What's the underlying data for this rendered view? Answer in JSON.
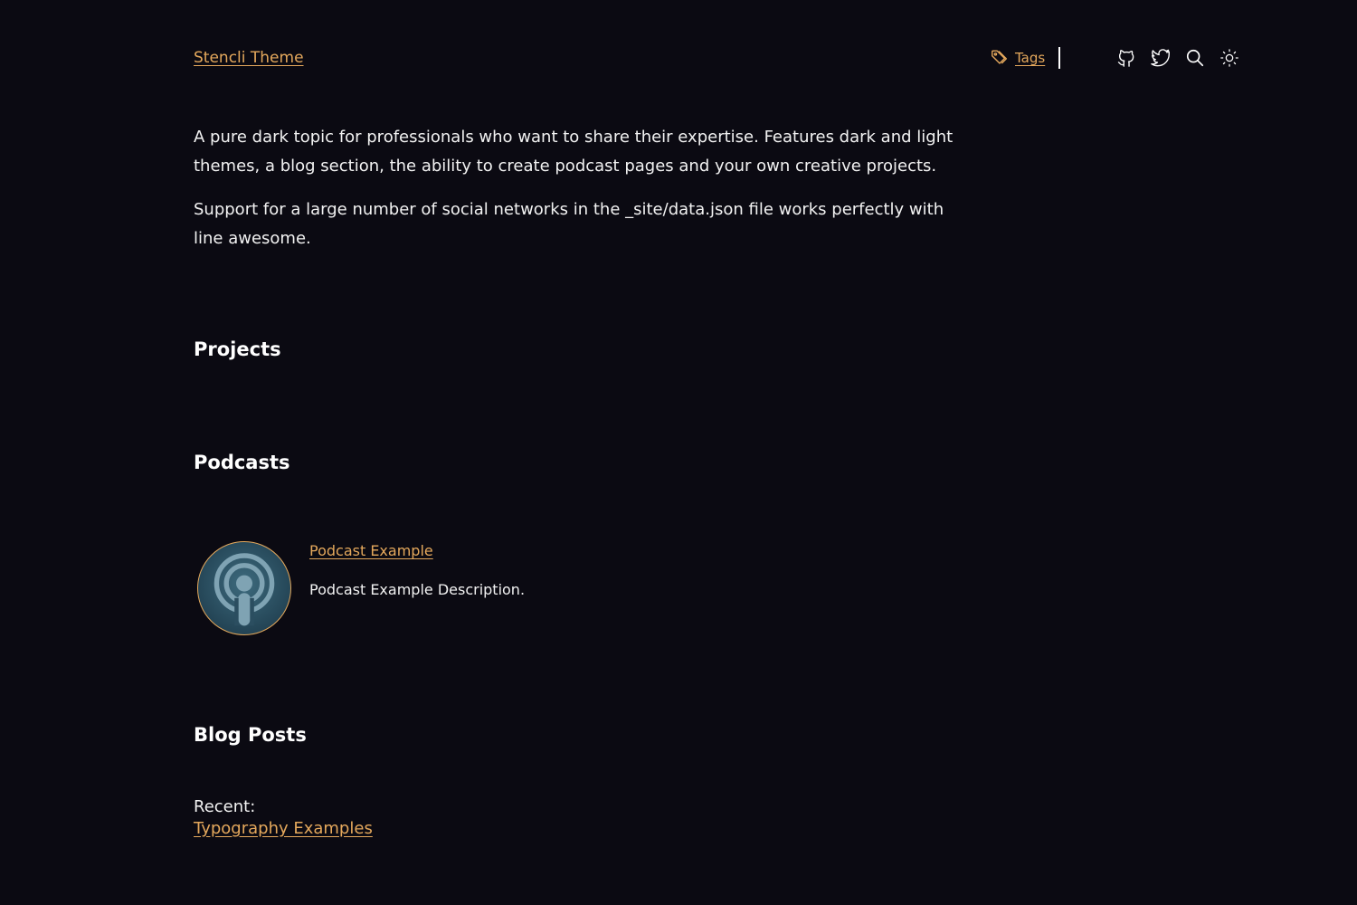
{
  "header": {
    "site_title": "Stencli Theme",
    "tags_label": "Tags",
    "icons": [
      "github-icon",
      "twitter-icon",
      "search-icon",
      "sun-icon"
    ]
  },
  "intro": {
    "paragraph_1": "A pure dark topic for professionals who want to share their expertise. Features dark and light themes, a blog section, the ability to create podcast pages and your own creative projects.",
    "paragraph_2": "Support for a large number of social networks in the _site/data.json file works perfectly with line awesome."
  },
  "sections": {
    "projects_heading": "Projects",
    "podcasts_heading": "Podcasts",
    "blog_heading": "Blog Posts"
  },
  "podcast": {
    "title": "Podcast Example",
    "description": "Podcast Example Description."
  },
  "blog": {
    "recent_label": "Recent:",
    "recent_link": "Typography Examples"
  },
  "colors": {
    "background": "#0b0a12",
    "accent": "#e4a85c",
    "text": "#f2f2f2"
  }
}
